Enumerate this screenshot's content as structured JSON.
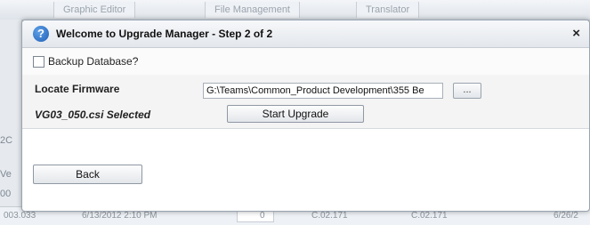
{
  "background": {
    "tabs": [
      "Graphic Editor",
      "File Management",
      "Translator"
    ],
    "left_fragments": [
      "2C",
      "Ve",
      "00"
    ],
    "row": {
      "id": "003.033",
      "date": "6/13/2012 2:10 PM",
      "num": "0",
      "ver1": "C.02.171",
      "ver2": "C.02.171",
      "date2": "6/26/2"
    }
  },
  "dialog": {
    "title": "Welcome to Upgrade Manager - Step 2 of 2",
    "help_icon": "?",
    "close_label": "×",
    "backup_label": "Backup Database?",
    "backup_checked": false,
    "locate_label": "Locate Firmware",
    "firmware_path": "G:\\Teams\\Common_Product Development\\355 Be",
    "browse_label": "...",
    "selected_label": "VG03_050.csi Selected",
    "start_label": "Start Upgrade",
    "back_label": "Back"
  }
}
